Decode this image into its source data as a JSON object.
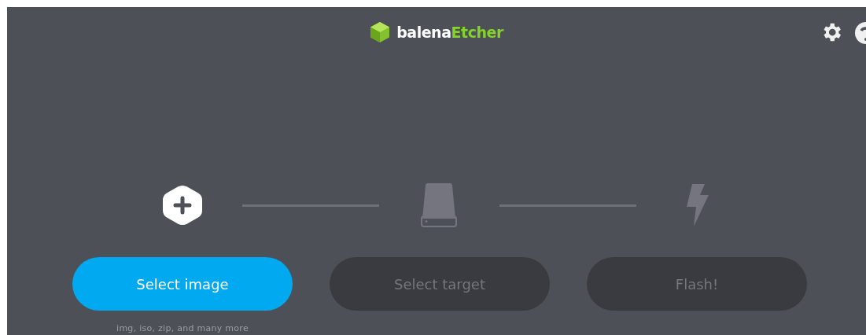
{
  "header": {
    "logo": {
      "name_part": "balena",
      "product_part": "Etcher"
    }
  },
  "steps": [
    {
      "kind": "image",
      "disabled": false
    },
    {
      "kind": "drive",
      "disabled": true
    },
    {
      "kind": "flash",
      "disabled": true
    }
  ],
  "buttons": [
    {
      "label": "Select image",
      "disabled": false
    },
    {
      "label": "Select target",
      "disabled": true
    },
    {
      "label": "Flash!",
      "disabled": true
    }
  ],
  "hint": "img, iso, zip, and many more"
}
